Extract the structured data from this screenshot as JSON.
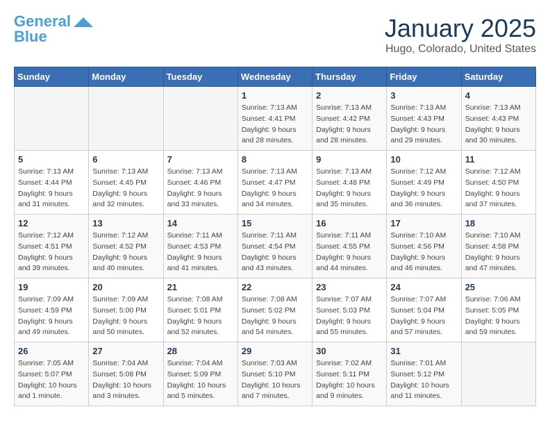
{
  "logo": {
    "line1": "General",
    "line2": "Blue"
  },
  "title": "January 2025",
  "subtitle": "Hugo, Colorado, United States",
  "days_of_week": [
    "Sunday",
    "Monday",
    "Tuesday",
    "Wednesday",
    "Thursday",
    "Friday",
    "Saturday"
  ],
  "weeks": [
    [
      {
        "day": "",
        "info": ""
      },
      {
        "day": "",
        "info": ""
      },
      {
        "day": "",
        "info": ""
      },
      {
        "day": "1",
        "info": "Sunrise: 7:13 AM\nSunset: 4:41 PM\nDaylight: 9 hours\nand 28 minutes."
      },
      {
        "day": "2",
        "info": "Sunrise: 7:13 AM\nSunset: 4:42 PM\nDaylight: 9 hours\nand 28 minutes."
      },
      {
        "day": "3",
        "info": "Sunrise: 7:13 AM\nSunset: 4:43 PM\nDaylight: 9 hours\nand 29 minutes."
      },
      {
        "day": "4",
        "info": "Sunrise: 7:13 AM\nSunset: 4:43 PM\nDaylight: 9 hours\nand 30 minutes."
      }
    ],
    [
      {
        "day": "5",
        "info": "Sunrise: 7:13 AM\nSunset: 4:44 PM\nDaylight: 9 hours\nand 31 minutes."
      },
      {
        "day": "6",
        "info": "Sunrise: 7:13 AM\nSunset: 4:45 PM\nDaylight: 9 hours\nand 32 minutes."
      },
      {
        "day": "7",
        "info": "Sunrise: 7:13 AM\nSunset: 4:46 PM\nDaylight: 9 hours\nand 33 minutes."
      },
      {
        "day": "8",
        "info": "Sunrise: 7:13 AM\nSunset: 4:47 PM\nDaylight: 9 hours\nand 34 minutes."
      },
      {
        "day": "9",
        "info": "Sunrise: 7:13 AM\nSunset: 4:48 PM\nDaylight: 9 hours\nand 35 minutes."
      },
      {
        "day": "10",
        "info": "Sunrise: 7:12 AM\nSunset: 4:49 PM\nDaylight: 9 hours\nand 36 minutes."
      },
      {
        "day": "11",
        "info": "Sunrise: 7:12 AM\nSunset: 4:50 PM\nDaylight: 9 hours\nand 37 minutes."
      }
    ],
    [
      {
        "day": "12",
        "info": "Sunrise: 7:12 AM\nSunset: 4:51 PM\nDaylight: 9 hours\nand 39 minutes."
      },
      {
        "day": "13",
        "info": "Sunrise: 7:12 AM\nSunset: 4:52 PM\nDaylight: 9 hours\nand 40 minutes."
      },
      {
        "day": "14",
        "info": "Sunrise: 7:11 AM\nSunset: 4:53 PM\nDaylight: 9 hours\nand 41 minutes."
      },
      {
        "day": "15",
        "info": "Sunrise: 7:11 AM\nSunset: 4:54 PM\nDaylight: 9 hours\nand 43 minutes."
      },
      {
        "day": "16",
        "info": "Sunrise: 7:11 AM\nSunset: 4:55 PM\nDaylight: 9 hours\nand 44 minutes."
      },
      {
        "day": "17",
        "info": "Sunrise: 7:10 AM\nSunset: 4:56 PM\nDaylight: 9 hours\nand 46 minutes."
      },
      {
        "day": "18",
        "info": "Sunrise: 7:10 AM\nSunset: 4:58 PM\nDaylight: 9 hours\nand 47 minutes."
      }
    ],
    [
      {
        "day": "19",
        "info": "Sunrise: 7:09 AM\nSunset: 4:59 PM\nDaylight: 9 hours\nand 49 minutes."
      },
      {
        "day": "20",
        "info": "Sunrise: 7:09 AM\nSunset: 5:00 PM\nDaylight: 9 hours\nand 50 minutes."
      },
      {
        "day": "21",
        "info": "Sunrise: 7:08 AM\nSunset: 5:01 PM\nDaylight: 9 hours\nand 52 minutes."
      },
      {
        "day": "22",
        "info": "Sunrise: 7:08 AM\nSunset: 5:02 PM\nDaylight: 9 hours\nand 54 minutes."
      },
      {
        "day": "23",
        "info": "Sunrise: 7:07 AM\nSunset: 5:03 PM\nDaylight: 9 hours\nand 55 minutes."
      },
      {
        "day": "24",
        "info": "Sunrise: 7:07 AM\nSunset: 5:04 PM\nDaylight: 9 hours\nand 57 minutes."
      },
      {
        "day": "25",
        "info": "Sunrise: 7:06 AM\nSunset: 5:05 PM\nDaylight: 9 hours\nand 59 minutes."
      }
    ],
    [
      {
        "day": "26",
        "info": "Sunrise: 7:05 AM\nSunset: 5:07 PM\nDaylight: 10 hours\nand 1 minute."
      },
      {
        "day": "27",
        "info": "Sunrise: 7:04 AM\nSunset: 5:08 PM\nDaylight: 10 hours\nand 3 minutes."
      },
      {
        "day": "28",
        "info": "Sunrise: 7:04 AM\nSunset: 5:09 PM\nDaylight: 10 hours\nand 5 minutes."
      },
      {
        "day": "29",
        "info": "Sunrise: 7:03 AM\nSunset: 5:10 PM\nDaylight: 10 hours\nand 7 minutes."
      },
      {
        "day": "30",
        "info": "Sunrise: 7:02 AM\nSunset: 5:11 PM\nDaylight: 10 hours\nand 9 minutes."
      },
      {
        "day": "31",
        "info": "Sunrise: 7:01 AM\nSunset: 5:12 PM\nDaylight: 10 hours\nand 11 minutes."
      },
      {
        "day": "",
        "info": ""
      }
    ]
  ]
}
